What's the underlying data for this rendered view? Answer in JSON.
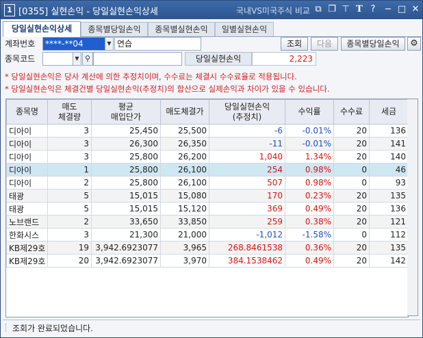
{
  "window": {
    "number": "1",
    "title": "[0355] 실현손익 - 당일실현손익상세",
    "compare_label": "국내VS미국주식 비교",
    "icons": [
      "copy-icon",
      "restore-icon",
      "pin-icon",
      "font-icon",
      "help-icon",
      "minimize-icon",
      "maximize-icon",
      "close-icon"
    ]
  },
  "tabs": [
    {
      "label": "당일실현손익상세",
      "active": true
    },
    {
      "label": "종목별당일손익",
      "active": false
    },
    {
      "label": "종목별실현손익",
      "active": false
    },
    {
      "label": "일별실현손익",
      "active": false
    }
  ],
  "form": {
    "account_label": "계좌번호",
    "account_value": "****-**04",
    "account_name": "연습",
    "stock_code_label": "종목코드",
    "stock_code_value": "",
    "stock_name_value": "",
    "query_button": "조회",
    "next_button": "다음",
    "by_stock_button": "종목별당일손익",
    "total_label": "당일실현손익",
    "total_value": "2,223"
  },
  "notes": [
    "* 당일실현손익은 당사 계산에 의한 추정치이며, 수수료는 체결시 수수료율로 적용됩니다.",
    "* 당일실현손익은 체결건별 당일실현손익(추정치)의 합산으로 실제손익과 차이가 있을 수 있습니다."
  ],
  "table": {
    "headers": [
      "종목명",
      "매도\n체결량",
      "평균\n매입단가",
      "매도체결가",
      "당일실현손익\n(추정치)",
      "수익률",
      "수수료",
      "세금"
    ],
    "rows": [
      {
        "name": "디아이",
        "qty": "3",
        "avg": "25,450",
        "sell": "25,500",
        "pnl": "-6",
        "rate": "-0.01%",
        "fee": "20",
        "tax": "136",
        "sign": "neg",
        "selected": false
      },
      {
        "name": "디아이",
        "qty": "3",
        "avg": "26,300",
        "sell": "26,350",
        "pnl": "-11",
        "rate": "-0.01%",
        "fee": "20",
        "tax": "141",
        "sign": "neg",
        "selected": false
      },
      {
        "name": "디아이",
        "qty": "3",
        "avg": "25,800",
        "sell": "26,200",
        "pnl": "1,040",
        "rate": "1.34%",
        "fee": "20",
        "tax": "140",
        "sign": "pos",
        "selected": false
      },
      {
        "name": "디아이",
        "qty": "1",
        "avg": "25,800",
        "sell": "26,100",
        "pnl": "254",
        "rate": "0.98%",
        "fee": "0",
        "tax": "46",
        "sign": "pos",
        "selected": true
      },
      {
        "name": "디아이",
        "qty": "2",
        "avg": "25,800",
        "sell": "26,100",
        "pnl": "507",
        "rate": "0.98%",
        "fee": "0",
        "tax": "93",
        "sign": "pos",
        "selected": false
      },
      {
        "name": "태광",
        "qty": "5",
        "avg": "15,015",
        "sell": "15,080",
        "pnl": "170",
        "rate": "0.23%",
        "fee": "20",
        "tax": "135",
        "sign": "pos",
        "selected": false
      },
      {
        "name": "태광",
        "qty": "5",
        "avg": "15,015",
        "sell": "15,120",
        "pnl": "369",
        "rate": "0.49%",
        "fee": "20",
        "tax": "136",
        "sign": "pos",
        "selected": false
      },
      {
        "name": "노브랜드",
        "qty": "2",
        "avg": "33,650",
        "sell": "33,850",
        "pnl": "259",
        "rate": "0.38%",
        "fee": "20",
        "tax": "121",
        "sign": "pos",
        "selected": false
      },
      {
        "name": "한화시스",
        "qty": "3",
        "avg": "21,300",
        "sell": "21,000",
        "pnl": "-1,012",
        "rate": "-1.58%",
        "fee": "0",
        "tax": "112",
        "sign": "neg",
        "selected": false
      },
      {
        "name": "KB제29호",
        "qty": "19",
        "avg": "3,942.6923077",
        "sell": "3,965",
        "pnl": "268.8461538",
        "rate": "0.36%",
        "fee": "20",
        "tax": "135",
        "sign": "pos",
        "selected": false
      },
      {
        "name": "KB제29호",
        "qty": "20",
        "avg": "3,942.6923077",
        "sell": "3,970",
        "pnl": "384.1538462",
        "rate": "0.49%",
        "fee": "20",
        "tax": "142",
        "sign": "pos",
        "selected": false
      }
    ]
  },
  "status": {
    "message": "조회가 완료되었습니다."
  },
  "colors": {
    "title_bar": "#2b5590",
    "note_red": "#d12020",
    "positive": "#dd1111",
    "negative": "#1d4fbf",
    "selected_row": "#cfe7f2"
  }
}
